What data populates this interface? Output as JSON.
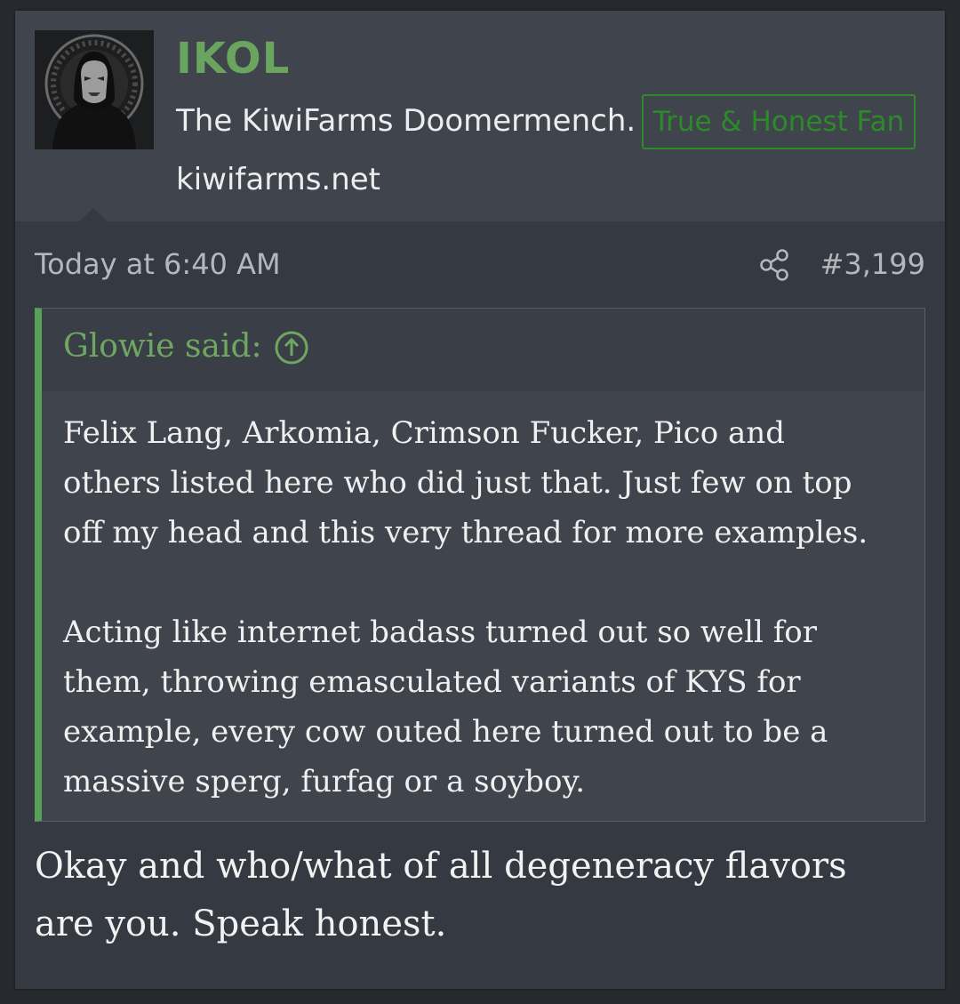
{
  "user": {
    "name": "IKOL",
    "title": "The KiwiFarms Doomermench.",
    "banner": "True & Honest Fan",
    "site": "kiwifarms.net"
  },
  "post": {
    "date": "Today at 6:40 AM",
    "number": "#3,199",
    "share_icon": "share-icon"
  },
  "quote": {
    "author_label": "Glowie said:",
    "expand_icon": "arrow-up-circle-icon",
    "paragraphs": [
      "Felix Lang, Arkomia, Crimson Fucker, Pico and\nothers listed here who did just that. Just few on top\noff my head and this very thread for more examples.",
      "Acting like internet badass turned out so well for\nthem, throwing emasculated variants of KYS for\nexample, every cow outed here turned out to be a\nmassive sperg, furfag or a soyboy."
    ]
  },
  "body": {
    "text": "Okay and who/what of all degeneracy flavors\nare you. Speak honest."
  },
  "colors": {
    "accent_green": "#6aa55f",
    "banner_green": "#2d8a2a",
    "quote_bar": "#56a058",
    "header_bg": "#40444c",
    "post_bg": "#353941"
  }
}
